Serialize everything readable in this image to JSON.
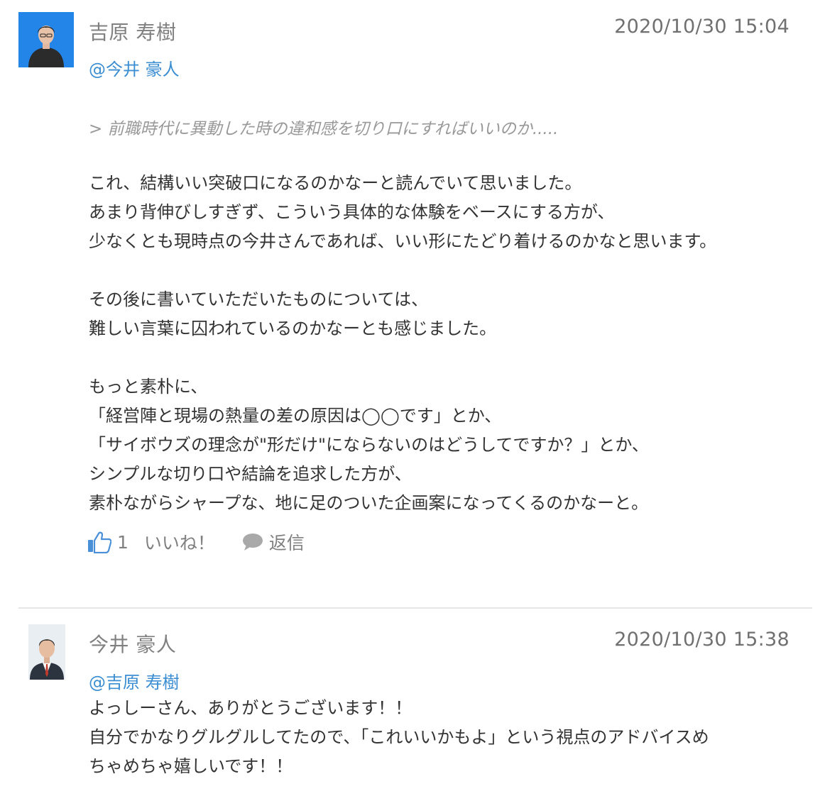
{
  "comments": [
    {
      "author": "吉原 寿樹",
      "timestamp": "2020/10/30 15:04",
      "mention": "@今井 豪人",
      "quote": "> 前職時代に異動した時の違和感を切り口にすればいいのか.....",
      "lines": [
        "これ、結構いい突破口になるのかなーと読んでいて思いました。",
        "あまり背伸びしすぎず、こういう具体的な体験をベースにする方が、",
        "少なくとも現時点の今井さんであれば、いい形にたどり着けるのかなと思います。",
        "",
        "その後に書いていただいたものについては、",
        "難しい言葉に囚われているのかなーとも感じました。",
        "",
        "もっと素朴に、",
        "「経営陣と現場の熱量の差の原因は◯◯です」とか、",
        "「サイボウズの理念が\"形だけ\"にならないのはどうしてですか？」とか、",
        "シンプルな切り口や結論を追求した方が、",
        "素朴ながらシャープな、地に足のついた企画案になってくるのかなーと。"
      ],
      "like_count": "1",
      "like_label": "いいね！",
      "reply_label": "返信",
      "like_icon": "thumbs-up-icon",
      "reply_icon": "speech-bubble-icon"
    },
    {
      "author": "今井 豪人",
      "timestamp": "2020/10/30 15:38",
      "mention": "@吉原 寿樹",
      "lines": [
        "よっしーさん、ありがとうございます！！",
        "自分でかなりグルグルしてたので、「これいいかもよ」という視点のアドバイスめ",
        "ちゃめちゃ嬉しいです！！"
      ]
    }
  ],
  "colors": {
    "link": "#3b8ed1",
    "like_icon": "#4a90d9",
    "muted": "#808080",
    "divider": "#e6e6e6"
  }
}
